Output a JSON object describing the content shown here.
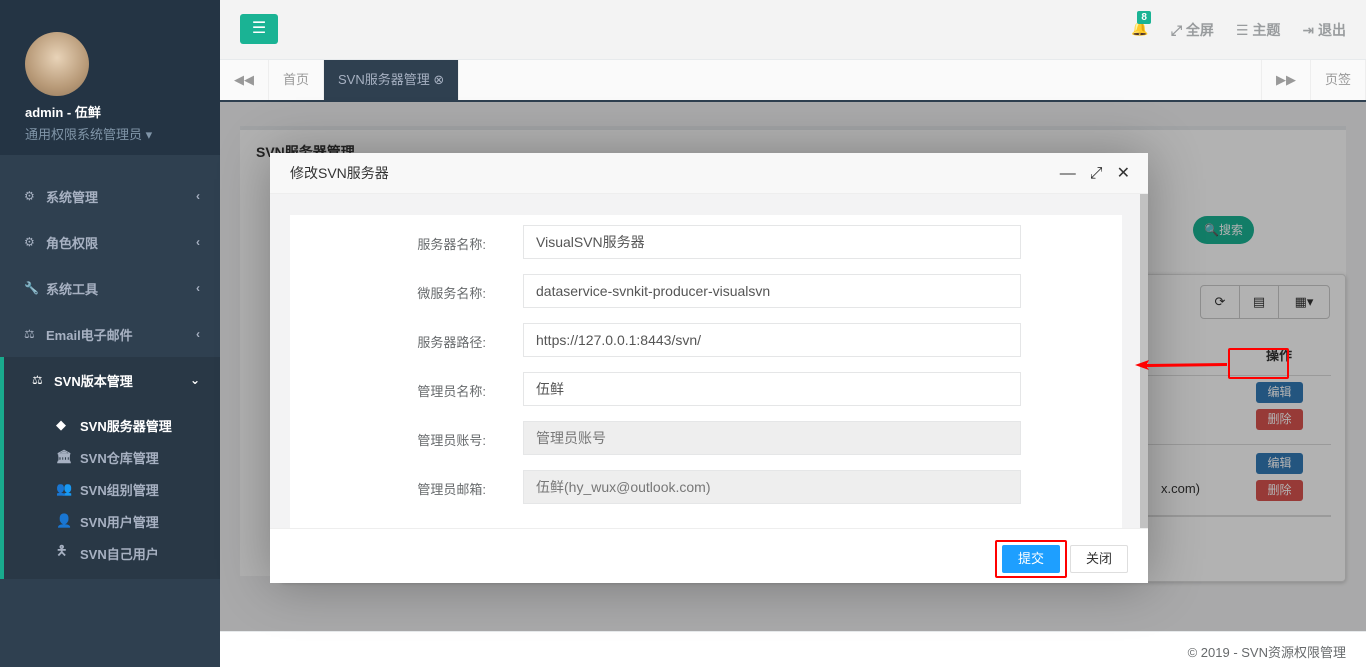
{
  "sidebar": {
    "user": "admin - 伍鲜",
    "role": "通用权限系统管理员",
    "items": [
      {
        "label": "系统管理",
        "icon": "gear-icon"
      },
      {
        "label": "角色权限",
        "icon": "cogs-icon"
      },
      {
        "label": "系统工具",
        "icon": "wrench-icon"
      },
      {
        "label": "Email电子邮件",
        "icon": "balance-icon"
      },
      {
        "label": "SVN版本管理",
        "icon": "balance-icon"
      }
    ],
    "subitems": [
      {
        "label": "SVN服务器管理",
        "icon": "diamond-icon"
      },
      {
        "label": "SVN仓库管理",
        "icon": "bank-icon"
      },
      {
        "label": "SVN组别管理",
        "icon": "users-icon"
      },
      {
        "label": "SVN用户管理",
        "icon": "user-icon"
      },
      {
        "label": "SVN自己用户",
        "icon": "male-icon"
      }
    ]
  },
  "header": {
    "badge": "8",
    "fullscreen": "全屏",
    "theme": "主题",
    "logout": "退出"
  },
  "tabs": {
    "home": "首页",
    "active": "SVN服务器管理",
    "pages": "页签"
  },
  "content": {
    "panel_title": "SVN服务器管理",
    "search": "搜索",
    "op_header": "操作",
    "edit": "编辑",
    "delete": "删除",
    "row2_cell": "x.com)"
  },
  "modal": {
    "title": "修改SVN服务器",
    "submit": "提交",
    "close": "关闭",
    "fields": [
      {
        "label": "服务器名称:",
        "value": "VisualSVN服务器"
      },
      {
        "label": "微服务名称:",
        "value": "dataservice-svnkit-producer-visualsvn"
      },
      {
        "label": "服务器路径:",
        "value": "https://127.0.0.1:8443/svn/"
      },
      {
        "label": "管理员名称:",
        "value": "伍鲜"
      },
      {
        "label": "管理员账号:",
        "placeholder": "管理员账号"
      },
      {
        "label": "管理员邮箱:",
        "value": "伍鲜(hy_wux@outlook.com)"
      }
    ]
  },
  "footer": "© 2019 - SVN资源权限管理",
  "colors": {
    "accent": "#1ab394",
    "sidebar": "#2f4050",
    "submit": "#1e9fff",
    "highlight": "#ff0000"
  }
}
